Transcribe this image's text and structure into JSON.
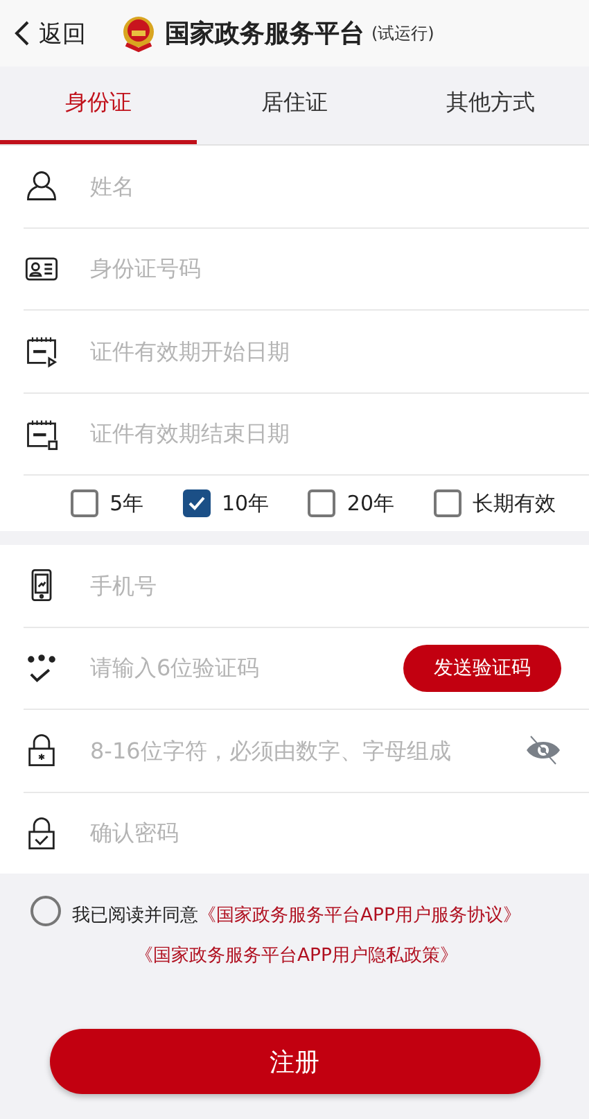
{
  "header": {
    "back": "返回",
    "title": "国家政务服务平台",
    "subtitle": "(试运行)"
  },
  "tabs": [
    {
      "label": "身份证",
      "selected": true
    },
    {
      "label": "居住证",
      "selected": false
    },
    {
      "label": "其他方式",
      "selected": false
    }
  ],
  "identity_fields": [
    {
      "placeholder": "姓名"
    },
    {
      "placeholder": "身份证号码"
    },
    {
      "placeholder": "证件有效期开始日期"
    },
    {
      "placeholder": "证件有效期结束日期"
    }
  ],
  "validity_options": [
    {
      "label": "5年",
      "checked": false
    },
    {
      "label": "10年",
      "checked": true
    },
    {
      "label": "20年",
      "checked": false
    },
    {
      "label": "长期有效",
      "checked": false
    }
  ],
  "account_fields": [
    {
      "placeholder": "手机号"
    },
    {
      "placeholder": "请输入6位验证码",
      "button": "发送验证码"
    },
    {
      "placeholder": "8-16位字符，必须由数字、字母组成",
      "password_visible": false
    },
    {
      "placeholder": "确认密码"
    }
  ],
  "agreement": {
    "checked": false,
    "text": "我已阅读并同意",
    "links": [
      "《国家政务服务平台APP用户服务协议》",
      "《国家政务服务平台APP用户隐私政策》"
    ]
  },
  "submit": "注册"
}
